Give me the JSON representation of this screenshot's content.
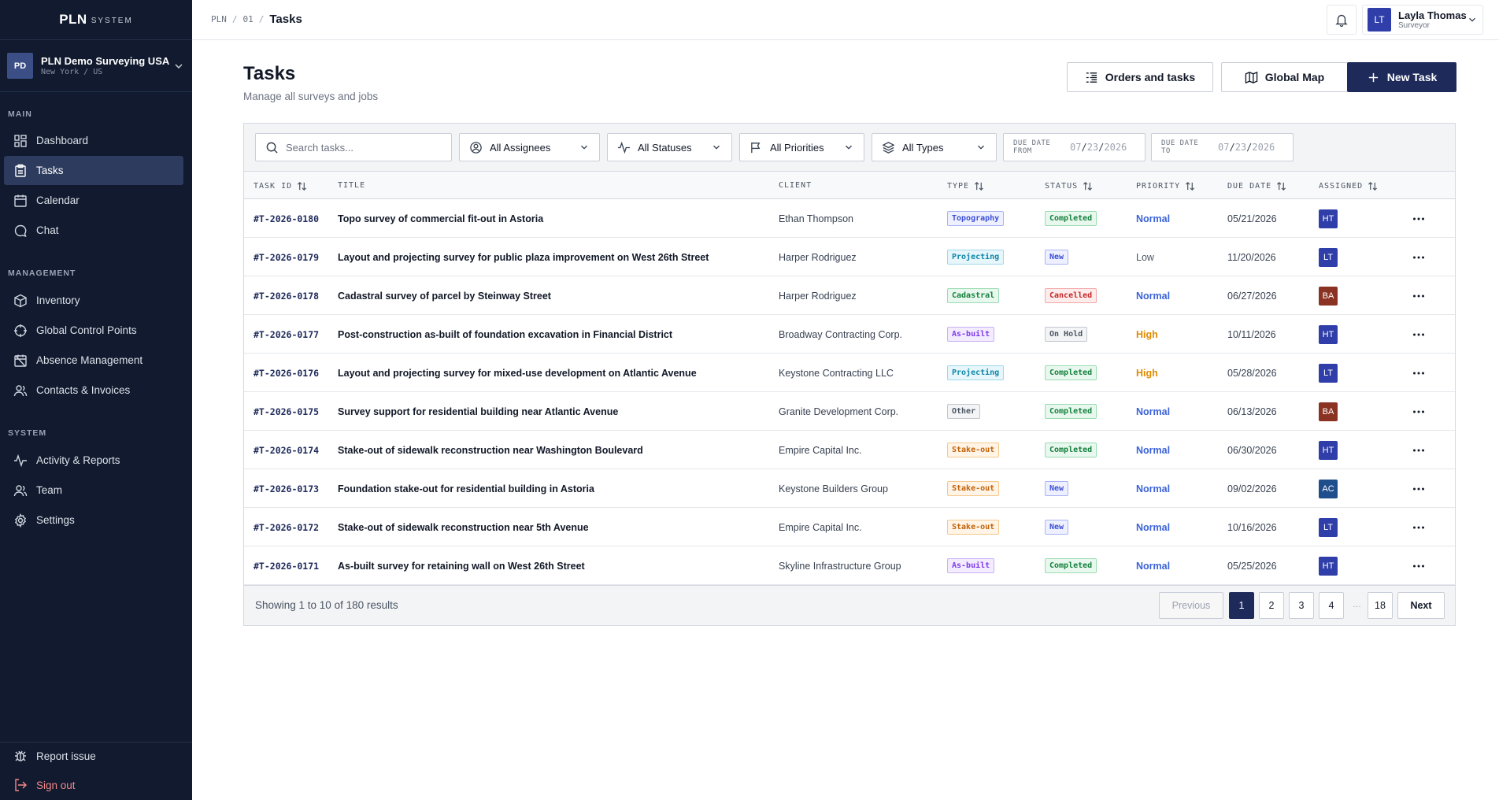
{
  "brand": {
    "main": "PLN",
    "sub": "SYSTEM"
  },
  "org": {
    "initials": "PD",
    "name": "PLN Demo Surveying USA",
    "location": "New York / US"
  },
  "nav": {
    "sections": [
      "MAIN",
      "MANAGEMENT",
      "SYSTEM"
    ],
    "main": [
      "Dashboard",
      "Tasks",
      "Calendar",
      "Chat"
    ],
    "management": [
      "Inventory",
      "Global Control Points",
      "Absence Management",
      "Contacts & Invoices"
    ],
    "system": [
      "Activity & Reports",
      "Team",
      "Settings"
    ],
    "bottom": [
      "Report issue",
      "Sign out"
    ]
  },
  "breadcrumb": [
    "PLN",
    "01",
    "Tasks"
  ],
  "user": {
    "initials": "LT",
    "name": "Layla Thomas",
    "role": "Surveyor"
  },
  "page": {
    "title": "Tasks",
    "subtitle": "Manage all surveys and jobs"
  },
  "buttons": {
    "orders": "Orders and tasks",
    "map": "Global Map",
    "new": "New Task"
  },
  "filters": {
    "search_placeholder": "Search tasks...",
    "assignees": "All Assignees",
    "statuses": "All Statuses",
    "priorities": "All Priorities",
    "types": "All Types",
    "due_from_label": "DUE DATE FROM",
    "due_to_label": "DUE DATE TO",
    "date_mm": "07",
    "date_dd": "23",
    "date_yyyy": "2026",
    "date_sep": "/"
  },
  "columns": [
    "TASK ID",
    "TITLE",
    "CLIENT",
    "TYPE",
    "STATUS",
    "PRIORITY",
    "DUE DATE",
    "ASSIGNED"
  ],
  "rows": [
    {
      "id": "#T-2026-0180",
      "title": "Topo survey of commercial fit-out in Astoria",
      "client": "Ethan Thompson",
      "type": "Topography",
      "status": "Completed",
      "priority": "Normal",
      "due": "05/21/2026",
      "assigned": "HT"
    },
    {
      "id": "#T-2026-0179",
      "title": "Layout and projecting survey for public plaza improvement on West 26th Street",
      "client": "Harper Rodriguez",
      "type": "Projecting",
      "status": "New",
      "priority": "Low",
      "due": "11/20/2026",
      "assigned": "LT"
    },
    {
      "id": "#T-2026-0178",
      "title": "Cadastral survey of parcel by Steinway Street",
      "client": "Harper Rodriguez",
      "type": "Cadastral",
      "status": "Cancelled",
      "priority": "Normal",
      "due": "06/27/2026",
      "assigned": "BA"
    },
    {
      "id": "#T-2026-0177",
      "title": "Post-construction as-built of foundation excavation in Financial District",
      "client": "Broadway Contracting Corp.",
      "type": "As-built",
      "status": "On Hold",
      "priority": "High",
      "due": "10/11/2026",
      "assigned": "HT"
    },
    {
      "id": "#T-2026-0176",
      "title": "Layout and projecting survey for mixed-use development on Atlantic Avenue",
      "client": "Keystone Contracting LLC",
      "type": "Projecting",
      "status": "Completed",
      "priority": "High",
      "due": "05/28/2026",
      "assigned": "LT"
    },
    {
      "id": "#T-2026-0175",
      "title": "Survey support for residential building near Atlantic Avenue",
      "client": "Granite Development Corp.",
      "type": "Other",
      "status": "Completed",
      "priority": "Normal",
      "due": "06/13/2026",
      "assigned": "BA"
    },
    {
      "id": "#T-2026-0174",
      "title": "Stake-out of sidewalk reconstruction near Washington Boulevard",
      "client": "Empire Capital Inc.",
      "type": "Stake-out",
      "status": "Completed",
      "priority": "Normal",
      "due": "06/30/2026",
      "assigned": "HT"
    },
    {
      "id": "#T-2026-0173",
      "title": "Foundation stake-out for residential building in Astoria",
      "client": "Keystone Builders Group",
      "type": "Stake-out",
      "status": "New",
      "priority": "Normal",
      "due": "09/02/2026",
      "assigned": "AC"
    },
    {
      "id": "#T-2026-0172",
      "title": "Stake-out of sidewalk reconstruction near 5th Avenue",
      "client": "Empire Capital Inc.",
      "type": "Stake-out",
      "status": "New",
      "priority": "Normal",
      "due": "10/16/2026",
      "assigned": "LT"
    },
    {
      "id": "#T-2026-0171",
      "title": "As-built survey for retaining wall on West 26th Street",
      "client": "Skyline Infrastructure Group",
      "type": "As-built",
      "status": "Completed",
      "priority": "Normal",
      "due": "05/25/2026",
      "assigned": "HT"
    }
  ],
  "pagination": {
    "showing": "Showing 1 to 10 of 180 results",
    "previous": "Previous",
    "pages": [
      "1",
      "2",
      "3",
      "4"
    ],
    "ellipsis": "…",
    "last": "18",
    "next": "Next"
  },
  "colors": {
    "type": {
      "Topography": [
        "#eef0ff",
        "#3b4fd8",
        "#a8b3f5"
      ],
      "Projecting": [
        "#e6f6fb",
        "#0e87a8",
        "#9fd8ea"
      ],
      "Cadastral": [
        "#e8f8ee",
        "#15803d",
        "#9bdcb2"
      ],
      "As-built": [
        "#f3ecff",
        "#7c3aed",
        "#c9b2f5"
      ],
      "Other": [
        "#f3f4f6",
        "#4b5563",
        "#c2c7d0"
      ],
      "Stake-out": [
        "#fff4e5",
        "#c2620a",
        "#f5c98d"
      ]
    },
    "status": {
      "Completed": [
        "#e8f8ee",
        "#15803d",
        "#9bdcb2"
      ],
      "New": [
        "#eef0ff",
        "#3b4fd8",
        "#a8b3f5"
      ],
      "Cancelled": [
        "#fdecec",
        "#c62828",
        "#f2a8a8"
      ],
      "On Hold": [
        "#f3f4f6",
        "#4b5563",
        "#c2c7d0"
      ]
    },
    "priority": {
      "Normal": "#3b63d8",
      "Low": "#4b5563",
      "High": "#e08a00"
    },
    "avatar": {
      "HT": "#2f3ea8",
      "LT": "#2f3ea8",
      "BA": "#8a3322",
      "AC": "#1f4e8c"
    }
  }
}
